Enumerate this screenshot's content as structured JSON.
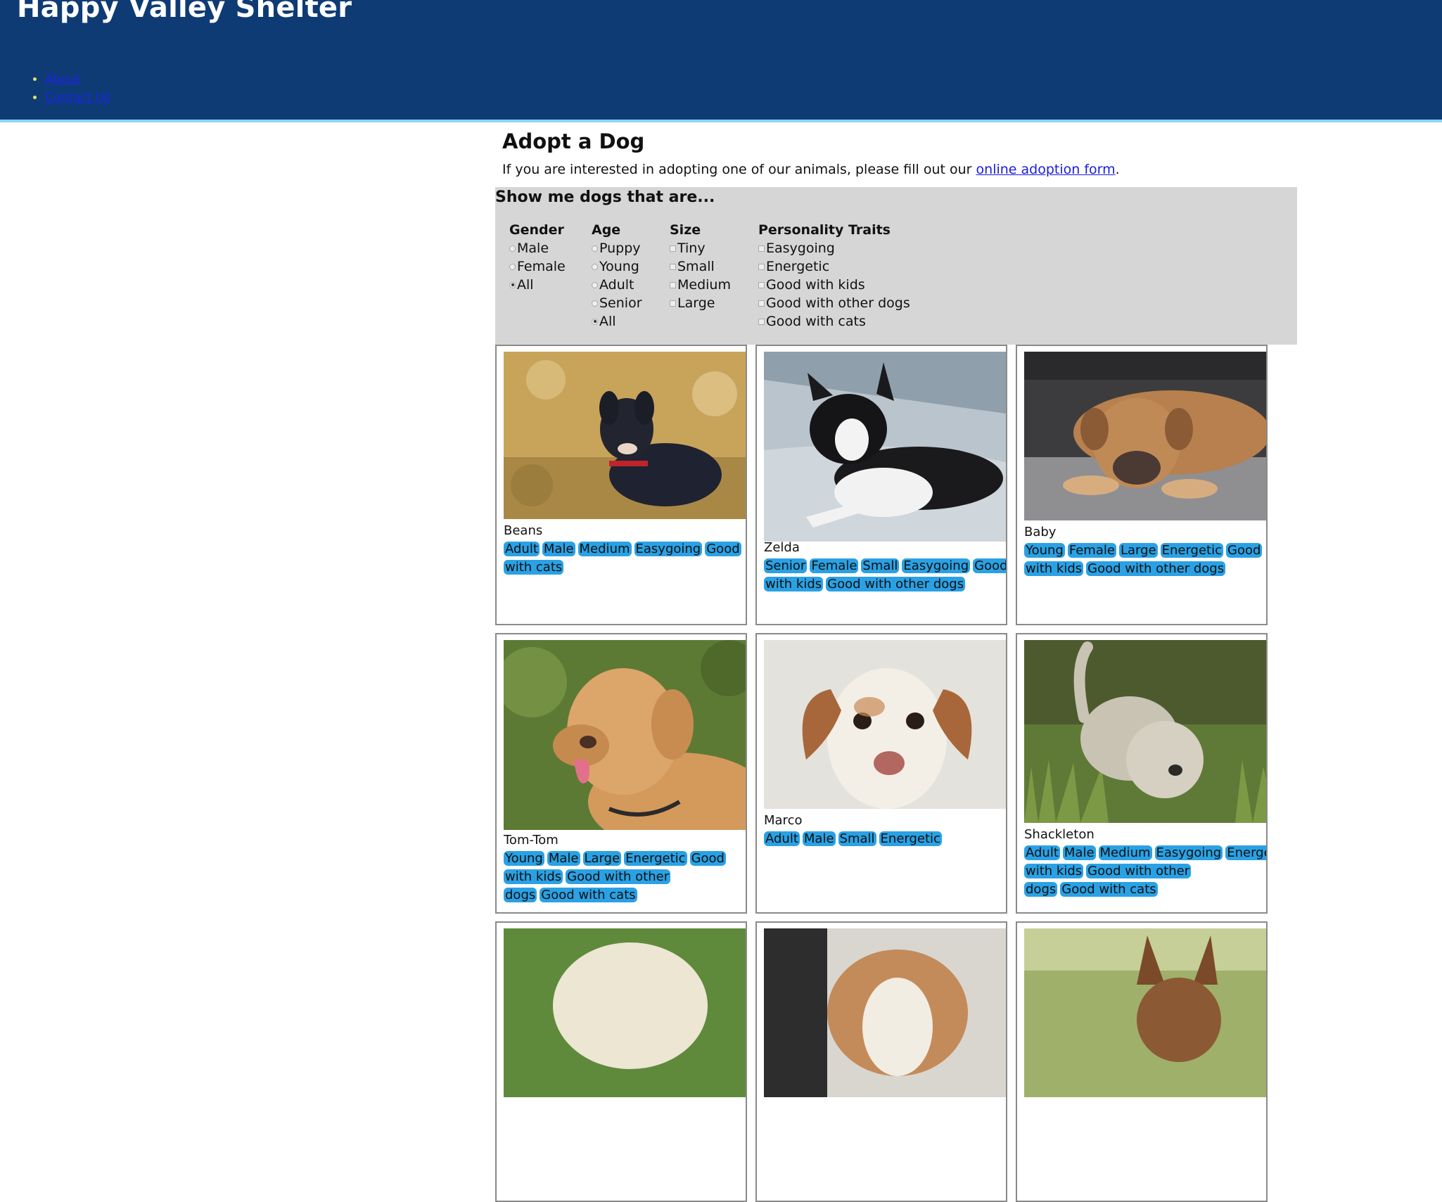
{
  "header": {
    "title": "Happy Valley Shelter",
    "nav": [
      "About",
      "Contact Us"
    ]
  },
  "main": {
    "title": "Adopt a Dog",
    "intro_prefix": "If you are interested in adopting one of our animals, please fill out our ",
    "intro_link": "online adoption form",
    "intro_suffix": "."
  },
  "filters": {
    "title": "Show me dogs that are...",
    "gender": {
      "label": "Gender",
      "options": [
        "Male",
        "Female",
        "All"
      ],
      "selected": "All"
    },
    "age": {
      "label": "Age",
      "options": [
        "Puppy",
        "Young",
        "Adult",
        "Senior",
        "All"
      ],
      "selected": "All"
    },
    "size": {
      "label": "Size",
      "options": [
        "Tiny",
        "Small",
        "Medium",
        "Large"
      ]
    },
    "traits": {
      "label": "Personality Traits",
      "options": [
        "Easygoing",
        "Energetic",
        "Good with kids",
        "Good with other dogs",
        "Good with cats"
      ]
    }
  },
  "dogs": [
    {
      "name": "Beans",
      "tags": [
        "Adult",
        "Male",
        "Medium",
        "Easygoing",
        "Good with cats"
      ]
    },
    {
      "name": "Zelda",
      "tags": [
        "Senior",
        "Female",
        "Small",
        "Easygoing",
        "Good with kids",
        "Good with other dogs"
      ]
    },
    {
      "name": "Baby",
      "tags": [
        "Young",
        "Female",
        "Large",
        "Energetic",
        "Good with kids",
        "Good with other dogs"
      ]
    },
    {
      "name": "Tom-Tom",
      "tags": [
        "Young",
        "Male",
        "Large",
        "Energetic",
        "Good with kids",
        "Good with other dogs",
        "Good with cats"
      ]
    },
    {
      "name": "Marco",
      "tags": [
        "Adult",
        "Male",
        "Small",
        "Energetic"
      ]
    },
    {
      "name": "Shackleton",
      "tags": [
        "Adult",
        "Male",
        "Medium",
        "Easygoing",
        "Energetic",
        "Good with kids",
        "Good with other dogs",
        "Good with cats"
      ]
    }
  ],
  "colors": {
    "header_bg": "#0f3b74",
    "filter_bg": "#d6d6d6",
    "tag_bg": "#2aa1e4"
  }
}
